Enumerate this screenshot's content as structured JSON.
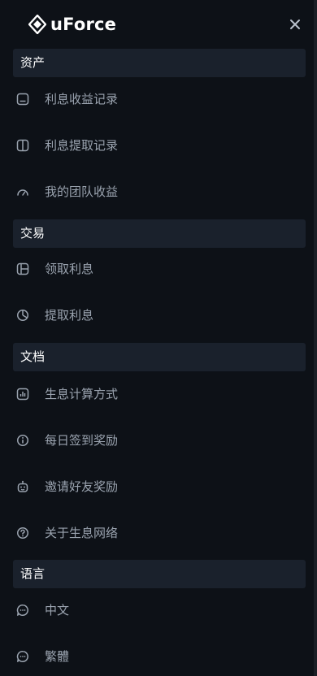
{
  "app": {
    "brand": "uForce",
    "close_icon": "close-icon",
    "colors": {
      "background": "#0d1117",
      "section_background": "#1a212c",
      "section_text": "#ffffff",
      "item_text": "#9aa3af",
      "icon": "#9aa3af"
    }
  },
  "menu": {
    "assets": {
      "title": "资产",
      "items": [
        {
          "label": "利息收益记录",
          "icon": "wallet-icon"
        },
        {
          "label": "利息提取记录",
          "icon": "columns-icon"
        },
        {
          "label": "我的团队收益",
          "icon": "gauge-icon"
        }
      ]
    },
    "trade": {
      "title": "交易",
      "items": [
        {
          "label": "领取利息",
          "icon": "layout-icon"
        },
        {
          "label": "提取利息",
          "icon": "pie-chart-icon"
        }
      ]
    },
    "docs": {
      "title": "文档",
      "items": [
        {
          "label": "生息计算方式",
          "icon": "bar-chart-icon"
        },
        {
          "label": "每日签到奖励",
          "icon": "info-icon"
        },
        {
          "label": "邀请好友奖励",
          "icon": "robot-icon"
        },
        {
          "label": "关于生息网络",
          "icon": "help-icon"
        }
      ]
    },
    "language": {
      "title": "语言",
      "items": [
        {
          "label": "中文",
          "icon": "chat-icon"
        },
        {
          "label": "繁體",
          "icon": "chat-icon"
        }
      ]
    }
  }
}
